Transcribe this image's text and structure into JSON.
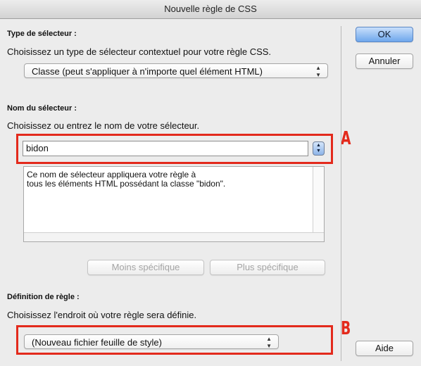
{
  "window": {
    "title": "Nouvelle règle de CSS"
  },
  "selector_type": {
    "heading": "Type de sélecteur :",
    "instruction": "Choisissez un type de sélecteur contextuel pour votre règle CSS.",
    "selected": "Classe (peut s'appliquer à n'importe quel élément HTML)"
  },
  "selector_name": {
    "heading": "Nom du sélecteur :",
    "instruction": "Choisissez ou entrez le nom de votre sélecteur.",
    "value": "bidon",
    "description_line1": "Ce nom de sélecteur appliquera votre règle à",
    "description_line2": "tous les éléments HTML possédant la classe \"bidon\".",
    "less_specific": "Moins spécifique",
    "more_specific": "Plus spécifique"
  },
  "rule_definition": {
    "heading": "Définition de règle :",
    "instruction": "Choisissez l'endroit où votre règle sera définie.",
    "selected": "(Nouveau fichier feuille de style)"
  },
  "buttons": {
    "ok": "OK",
    "cancel": "Annuler",
    "help": "Aide"
  },
  "annotations": {
    "a": "A",
    "b": "B"
  },
  "colors": {
    "annotation_red": "#e32a1c",
    "default_button": "#6ea7ec"
  }
}
